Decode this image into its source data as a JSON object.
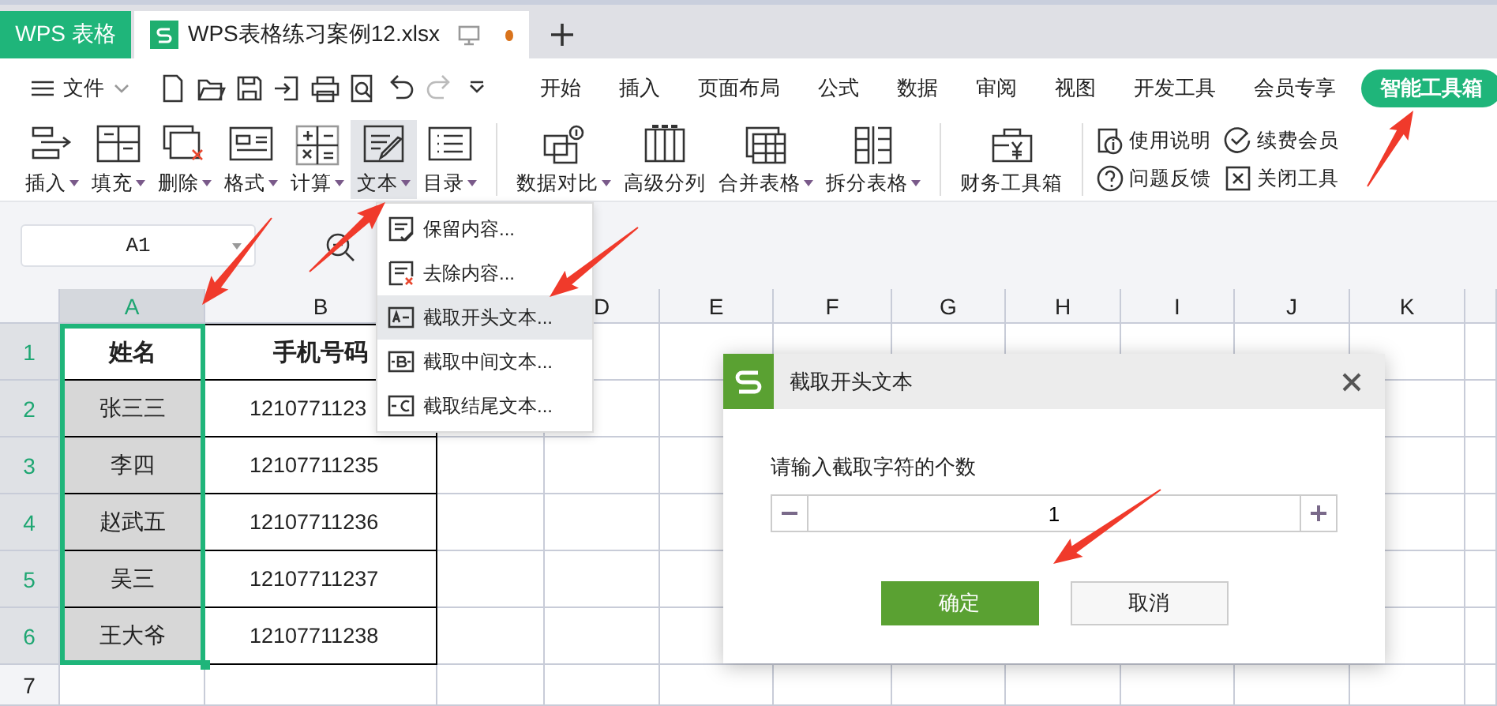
{
  "title_bar": {
    "app_tab": "WPS 表格",
    "document_tab": {
      "title": "WPS表格练习案例12.xlsx",
      "unsaved": true
    }
  },
  "menu_bar": {
    "file_menu": "文件",
    "tabs": [
      {
        "label": "开始",
        "selected": false
      },
      {
        "label": "插入",
        "selected": false
      },
      {
        "label": "页面布局",
        "selected": false
      },
      {
        "label": "公式",
        "selected": false
      },
      {
        "label": "数据",
        "selected": false
      },
      {
        "label": "审阅",
        "selected": false
      },
      {
        "label": "视图",
        "selected": false
      },
      {
        "label": "开发工具",
        "selected": false
      },
      {
        "label": "会员专享",
        "selected": false
      },
      {
        "label": "智能工具箱",
        "selected": true
      }
    ]
  },
  "ribbon": {
    "tools": [
      {
        "label": "插入",
        "dropdown": true,
        "selected": false
      },
      {
        "label": "填充",
        "dropdown": true,
        "selected": false
      },
      {
        "label": "删除",
        "dropdown": true,
        "selected": false
      },
      {
        "label": "格式",
        "dropdown": true,
        "selected": false
      },
      {
        "label": "计算",
        "dropdown": true,
        "selected": false
      },
      {
        "label": "文本",
        "dropdown": true,
        "selected": true
      },
      {
        "label": "目录",
        "dropdown": true,
        "selected": false
      },
      {
        "label": "数据对比",
        "dropdown": true,
        "selected": false
      },
      {
        "label": "高级分列",
        "dropdown": false,
        "selected": false
      },
      {
        "label": "合并表格",
        "dropdown": true,
        "selected": false
      },
      {
        "label": "拆分表格",
        "dropdown": true,
        "selected": false
      },
      {
        "label": "财务工具箱",
        "dropdown": false,
        "selected": false
      }
    ],
    "links": [
      {
        "label": "使用说明"
      },
      {
        "label": "问题反馈"
      },
      {
        "label": "续费会员"
      },
      {
        "label": "关闭工具"
      }
    ]
  },
  "formula_bar": {
    "name_box": "A1"
  },
  "sheet": {
    "columns": [
      {
        "label": "A",
        "selected": true
      },
      {
        "label": "B",
        "selected": false
      },
      {
        "label": "D",
        "selected": false
      },
      {
        "label": "E",
        "selected": false
      },
      {
        "label": "F",
        "selected": false
      },
      {
        "label": "G",
        "selected": false
      },
      {
        "label": "H",
        "selected": false
      },
      {
        "label": "I",
        "selected": false
      },
      {
        "label": "J",
        "selected": false
      },
      {
        "label": "K",
        "selected": false
      }
    ],
    "rows": [
      {
        "header": "1",
        "selected": true,
        "kind": "header",
        "cells": [
          {
            "text": "姓名",
            "selected": false,
            "active": true
          },
          {
            "text": "手机号码",
            "selected": false
          }
        ]
      },
      {
        "header": "2",
        "selected": true,
        "kind": "data",
        "cells": [
          {
            "text": "张三三",
            "selected": true
          },
          {
            "text": "1210771123",
            "selected": false
          }
        ]
      },
      {
        "header": "3",
        "selected": true,
        "kind": "data",
        "cells": [
          {
            "text": "李四",
            "selected": true
          },
          {
            "text": "12107711235",
            "selected": false
          }
        ]
      },
      {
        "header": "4",
        "selected": true,
        "kind": "data",
        "cells": [
          {
            "text": "赵武五",
            "selected": true
          },
          {
            "text": "12107711236",
            "selected": false
          }
        ]
      },
      {
        "header": "5",
        "selected": true,
        "kind": "data",
        "cells": [
          {
            "text": "吴三",
            "selected": true
          },
          {
            "text": "12107711237",
            "selected": false
          }
        ]
      },
      {
        "header": "6",
        "selected": true,
        "kind": "data",
        "cells": [
          {
            "text": "王大爷",
            "selected": true
          },
          {
            "text": "12107711238",
            "selected": false
          }
        ]
      },
      {
        "header": "7",
        "selected": false,
        "cells": []
      }
    ]
  },
  "text_menu": {
    "items": [
      {
        "label": "保留内容...",
        "selected": false
      },
      {
        "label": "去除内容...",
        "selected": false
      },
      {
        "label": "截取开头文本...",
        "selected": true
      },
      {
        "label": "截取中间文本...",
        "selected": false
      },
      {
        "label": "截取结尾文本...",
        "selected": false
      }
    ]
  },
  "dialog": {
    "title": "截取开头文本",
    "prompt": "请输入截取字符的个数",
    "value": "1",
    "buttons": [
      {
        "label": "确定",
        "kind": "primary"
      },
      {
        "label": "取消",
        "kind": "secondary"
      }
    ]
  }
}
